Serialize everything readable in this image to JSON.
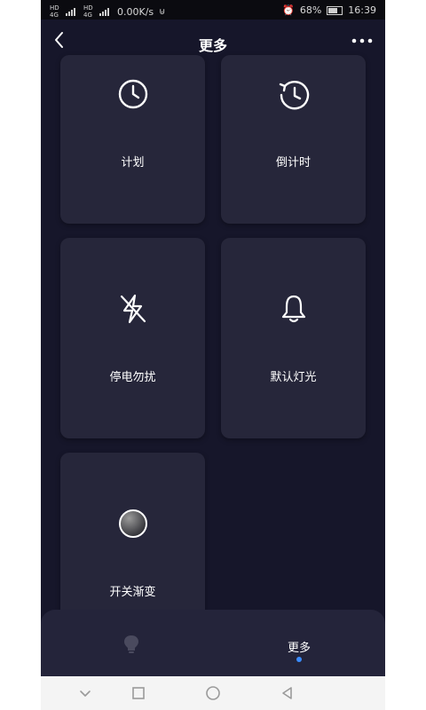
{
  "status_bar": {
    "network_speed": "0.00K/s",
    "signal_label_1": "HD 4G",
    "signal_label_2": "HD 4G",
    "battery_percent": "68%",
    "battery_level": 0.68,
    "time": "16:39"
  },
  "header": {
    "title": "更多"
  },
  "cards": [
    {
      "label": "计划",
      "icon": "clock-icon"
    },
    {
      "label": "倒计时",
      "icon": "countdown-icon"
    },
    {
      "label": "停电勿扰",
      "icon": "flash-off-icon"
    },
    {
      "label": "默认灯光",
      "icon": "bell-icon"
    },
    {
      "label": "开关渐变",
      "icon": "gradient-circle-icon"
    }
  ],
  "bottom_nav": {
    "items": [
      {
        "label": "",
        "icon": "bulb-icon"
      },
      {
        "label": "更多",
        "active": true
      }
    ],
    "active_color": "#3a8cff"
  },
  "colors": {
    "background": "#16162a",
    "card": "#26263a",
    "text": "#ffffff"
  }
}
